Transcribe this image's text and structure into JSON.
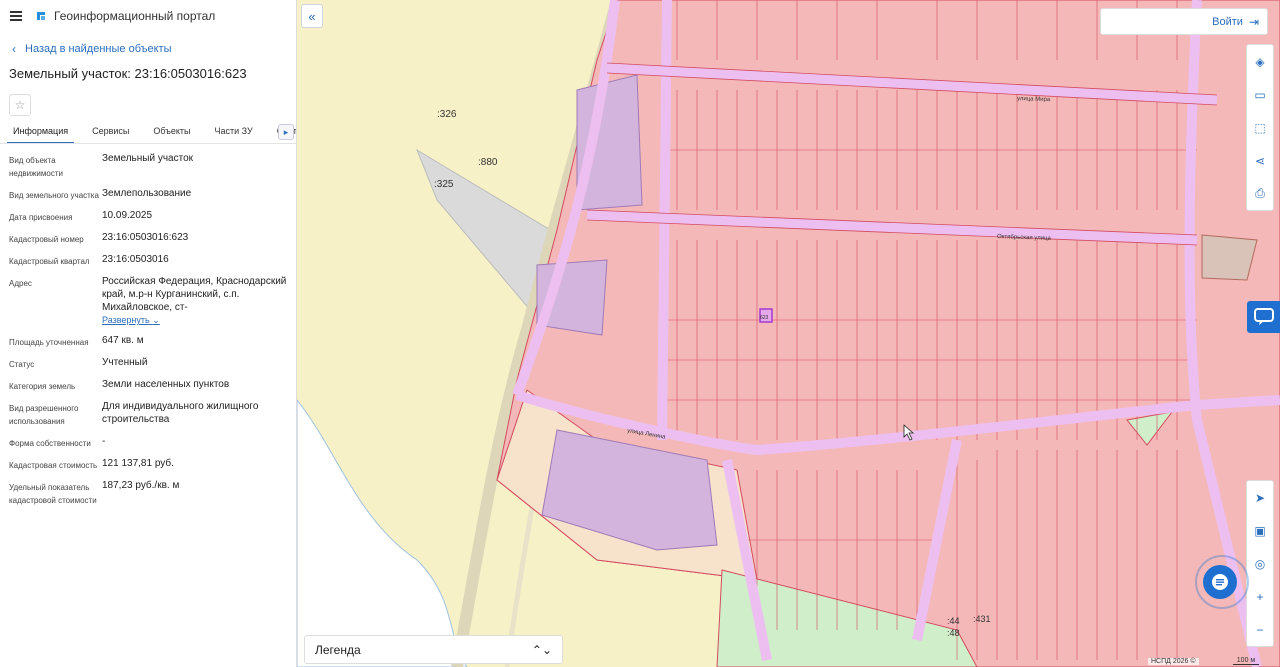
{
  "header": {
    "title": "Геоинформационный портал"
  },
  "back_link": "Назад в найденные объекты",
  "object_title": "Земельный участок: 23:16:0503016:623",
  "tabs": [
    {
      "label": "Информация",
      "active": true
    },
    {
      "label": "Сервисы"
    },
    {
      "label": "Объекты"
    },
    {
      "label": "Части ЗУ"
    },
    {
      "label": "Состав"
    }
  ],
  "properties": [
    {
      "key": "Вид объекта недвижимости",
      "value": "Земельный участок"
    },
    {
      "key": "Вид земельного участка",
      "value": "Землепользование"
    },
    {
      "key": "Дата присвоения",
      "value": "10.09.2025"
    },
    {
      "key": "Кадастровый номер",
      "value": "23:16:0503016:623"
    },
    {
      "key": "Кадастровый квартал",
      "value": "23:16:0503016"
    },
    {
      "key": "Адрес",
      "value": "Российская Федерация, Краснодарский край, м.р-н Курганинский, с.п. Михайловское, ст-",
      "expand": "Развернуть"
    },
    {
      "key": "Площадь уточненная",
      "value": "647 кв. м"
    },
    {
      "key": "Статус",
      "value": "Учтенный"
    },
    {
      "key": "Категория земель",
      "value": "Земли населенных пунктов"
    },
    {
      "key": "Вид разрешенного использования",
      "value": "Для индивидуального жилищного строительства"
    },
    {
      "key": "Форма собственности",
      "value": "-"
    },
    {
      "key": "Кадастровая стоимость",
      "value": "121 137,81 руб."
    },
    {
      "key": "Удельный показатель кадастровой стоимости",
      "value": "187,23 руб./кв. м"
    }
  ],
  "login": "Войти",
  "legend": "Легенда",
  "map": {
    "attribution": "НСПД 2026 ©",
    "scale": "100 м",
    "colors": {
      "parcel": "#f5b8b8",
      "parcel_edge": "#d24b5f",
      "road": "#ecbff0",
      "field": "#f7f1c8",
      "green": "#cfeec9",
      "selected": "#a23bd0"
    },
    "labels": [
      {
        "text": ":326"
      },
      {
        "text": ":880"
      },
      {
        "text": ":325"
      },
      {
        "text": "улица Мира"
      },
      {
        "text": "Октябрьская улица"
      },
      {
        "text": "улица Ленина"
      },
      {
        "text": "623"
      },
      {
        "text": ":44"
      },
      {
        "text": ":48"
      },
      {
        "text": ":431"
      }
    ]
  }
}
